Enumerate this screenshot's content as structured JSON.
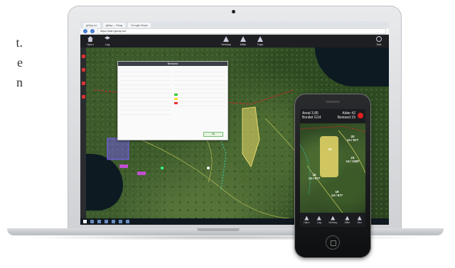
{
  "side_text": [
    "t.",
    "e",
    "n"
  ],
  "browser": {
    "tabs": [
      "gMap.no",
      "gMap – Skog",
      "Google Maps"
    ],
    "url": "https://kart.gmap.no/"
  },
  "desktop_toolbar": {
    "items": [
      "Hjem",
      "Lag",
      "Verktøy",
      "Måle",
      "Tegn",
      "Søk"
    ]
  },
  "popup": {
    "title": "Bestand",
    "ok_label": "Ok"
  },
  "phone": {
    "status_left": [
      "Areal 3,85",
      "Bonitet G14"
    ],
    "status_right": [
      "Alder 42",
      "Bestand 15"
    ],
    "stand_labels": [
      {
        "id": "st-20",
        "text": "20\n14 / 677"
      },
      {
        "id": "st-23",
        "text": "23\n14 / 1287"
      },
      {
        "id": "st-15",
        "text": "15\n14 / 677"
      },
      {
        "id": "st-19",
        "text": "19\n14 / 677"
      },
      {
        "id": "st-16",
        "text": "16"
      }
    ],
    "toolbar": [
      "Hjem",
      "Lag",
      "Verktøy",
      "Måle",
      "Mer"
    ]
  },
  "colors": {
    "stand_fill": "#e8d76a",
    "property_line": "#e02020",
    "selection": "#7a5cff",
    "record": "#e02020"
  }
}
